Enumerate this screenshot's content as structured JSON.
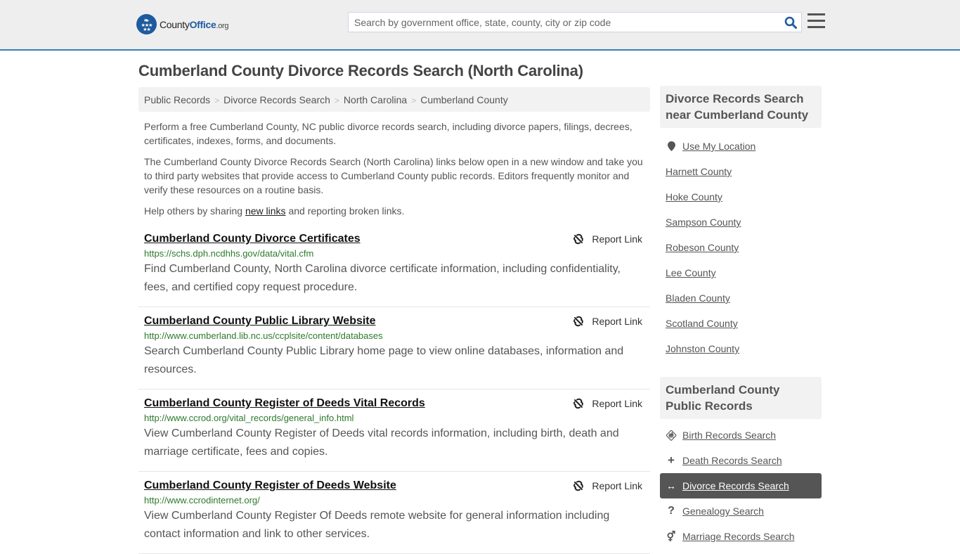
{
  "header": {
    "logo": {
      "name": "County",
      "name_bold": "Office",
      "tld": ".org"
    },
    "search": {
      "placeholder": "Search by government office, state, county, city or zip code",
      "value": ""
    },
    "icons": {
      "search": "search-icon",
      "menu": "hamburger-menu-icon"
    },
    "accent_color": "#3a7fb4"
  },
  "page": {
    "title": "Cumberland County Divorce Records Search (North Carolina)"
  },
  "breadcrumb": [
    {
      "label": "Public Records"
    },
    {
      "label": "Divorce Records Search"
    },
    {
      "label": "North Carolina"
    },
    {
      "label": "Cumberland County"
    }
  ],
  "intro": {
    "p1": "Perform a free Cumberland County, NC public divorce records search, including divorce papers, filings, decrees, certificates, indexes, forms, and documents.",
    "p2": "The Cumberland County Divorce Records Search (North Carolina) links below open in a new window and take you to third party websites that provide access to Cumberland County public records. Editors frequently monitor and verify these resources on a routine basis.",
    "p3_before": "Help others by sharing ",
    "p3_link": "new links",
    "p3_after": " and reporting broken links."
  },
  "results": [
    {
      "title": "Cumberland County Divorce Certificates",
      "url": "https://schs.dph.ncdhhs.gov/data/vital.cfm",
      "description": "Find Cumberland County, North Carolina divorce certificate information, including confidentiality, fees, and certified copy request procedure.",
      "report_label": "Report Link"
    },
    {
      "title": "Cumberland County Public Library Website",
      "url": "http://www.cumberland.lib.nc.us/ccplsite/content/databases",
      "description": "Search Cumberland County Public Library home page to view online databases, information and resources.",
      "report_label": "Report Link"
    },
    {
      "title": "Cumberland County Register of Deeds Vital Records",
      "url": "http://www.ccrod.org/vital_records/general_info.html",
      "description": "View Cumberland County Register of Deeds vital records information, including birth, death and marriage certificate, fees and copies.",
      "report_label": "Report Link"
    },
    {
      "title": "Cumberland County Register of Deeds Website",
      "url": "http://www.ccrodinternet.org/",
      "description": "View Cumberland County Register Of Deeds remote website for general information including contact information and link to other services.",
      "report_label": "Report Link"
    }
  ],
  "sidebar": {
    "nearby": {
      "heading": "Divorce Records Search near Cumberland County",
      "use_location": "Use My Location",
      "counties": [
        "Harnett County",
        "Hoke County",
        "Sampson County",
        "Robeson County",
        "Lee County",
        "Bladen County",
        "Scotland County",
        "Johnston County"
      ]
    },
    "public_records": {
      "heading": "Cumberland County Public Records",
      "items": [
        {
          "label": "Birth Records Search",
          "icon": "child-icon",
          "active": false
        },
        {
          "label": "Death Records Search",
          "icon": "plus-icon",
          "active": false
        },
        {
          "label": "Divorce Records Search",
          "icon": "arrows-horizontal-icon",
          "active": true
        },
        {
          "label": "Genealogy Search",
          "icon": "question-icon",
          "active": false
        },
        {
          "label": "Marriage Records Search",
          "icon": "venus-mars-icon",
          "active": false
        }
      ]
    }
  }
}
